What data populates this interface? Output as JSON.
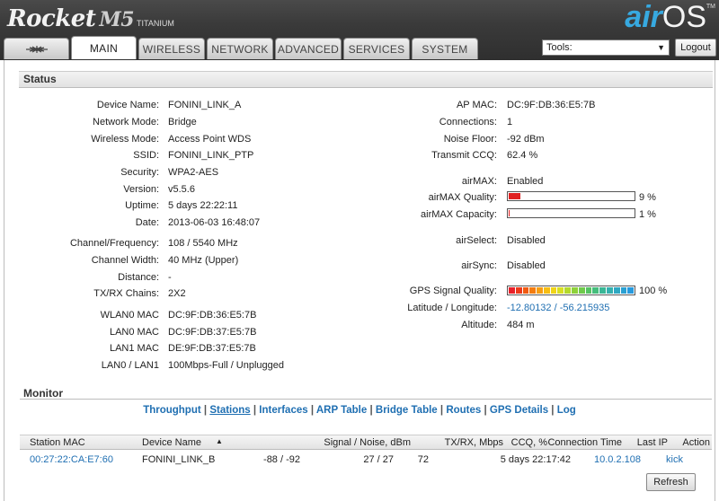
{
  "header": {
    "brand": "Rocket",
    "model": "M5",
    "model_sub": "TITANIUM",
    "logo_air": "air",
    "logo_os": "OS",
    "logo_tm": "TM"
  },
  "tabs": [
    {
      "label": "MAIN",
      "active": true
    },
    {
      "label": "WIRELESS"
    },
    {
      "label": "NETWORK"
    },
    {
      "label": "ADVANCED"
    },
    {
      "label": "SERVICES"
    },
    {
      "label": "SYSTEM"
    }
  ],
  "tools": {
    "selected": "Tools:"
  },
  "logout_label": "Logout",
  "status": {
    "title": "Status",
    "left": [
      {
        "k": "Device Name:",
        "v": "FONINI_LINK_A"
      },
      {
        "k": "Network Mode:",
        "v": "Bridge"
      },
      {
        "k": "Wireless Mode:",
        "v": "Access Point WDS"
      },
      {
        "k": "SSID:",
        "v": "FONINI_LINK_PTP"
      },
      {
        "k": "Security:",
        "v": "WPA2-AES"
      },
      {
        "k": "Version:",
        "v": "v5.5.6"
      },
      {
        "k": "Uptime:",
        "v": "5 days 22:22:11"
      },
      {
        "k": "Date:",
        "v": "2013-06-03 16:48:07"
      },
      {
        "k": "Channel/Frequency:",
        "v": "108 / 5540 MHz"
      },
      {
        "k": "Channel Width:",
        "v": "40 MHz (Upper)"
      },
      {
        "k": "Distance:",
        "v": "-"
      },
      {
        "k": "TX/RX Chains:",
        "v": "2X2"
      },
      {
        "k": "WLAN0 MAC",
        "v": "DC:9F:DB:36:E5:7B"
      },
      {
        "k": "LAN0 MAC",
        "v": "DC:9F:DB:37:E5:7B"
      },
      {
        "k": "LAN1 MAC",
        "v": "DE:9F:DB:37:E5:7B"
      },
      {
        "k": "LAN0 / LAN1",
        "v": "100Mbps-Full / Unplugged"
      }
    ],
    "right": [
      {
        "k": "AP MAC:",
        "v": "DC:9F:DB:36:E5:7B"
      },
      {
        "k": "Connections:",
        "v": "1"
      },
      {
        "k": "Noise Floor:",
        "v": "-92 dBm"
      },
      {
        "k": "Transmit CCQ:",
        "v": "62.4 %"
      },
      {
        "k": "airMAX:",
        "v": "Enabled"
      },
      {
        "k": "airMAX Quality:",
        "v": "9 %",
        "level": 0.09
      },
      {
        "k": "airMAX Capacity:",
        "v": "1 %",
        "level": 0.01
      },
      {
        "k": "airSelect:",
        "v": "Disabled"
      },
      {
        "k": "airSync:",
        "v": "Disabled"
      },
      {
        "k": "GPS Signal Quality:",
        "v": "100 %",
        "level": 1.0
      },
      {
        "k": "Latitude / Longitude:",
        "v": "-12.80132 / -56.215935"
      },
      {
        "k": "Altitude:",
        "v": "484 m"
      }
    ]
  },
  "monitor": {
    "title": "Monitor",
    "links": [
      "Throughput",
      "Stations",
      "Interfaces",
      "ARP Table",
      "Bridge Table",
      "Routes",
      "GPS Details",
      "Log"
    ],
    "active_link": "Stations",
    "columns": [
      "Station MAC",
      "Device Name",
      "Signal / Noise, dBm",
      "TX/RX, Mbps",
      "CCQ, %",
      "Connection Time",
      "Last IP",
      "Action"
    ],
    "rows": [
      [
        "00:27:22:CA:E7:60",
        "FONINI_LINK_B",
        "-88 / -92",
        "27 / 27",
        "72",
        "5 days 22:17:42",
        "10.0.2.108",
        "kick"
      ]
    ],
    "refresh_label": "Refresh"
  },
  "colors": {
    "accent_blue": "#1f6fb2",
    "bar_red": "#e02020",
    "gps_gradient": [
      "#e8202a",
      "#ec3a1c",
      "#f05a12",
      "#f47d10",
      "#f79e12",
      "#f7be14",
      "#f0d418",
      "#d8df22",
      "#b4d92c",
      "#8ed13a",
      "#6fca4c",
      "#55c262",
      "#45bd7c",
      "#3ab796",
      "#34b0ae",
      "#2fa8c2",
      "#2aa0d2",
      "#279ade"
    ]
  }
}
